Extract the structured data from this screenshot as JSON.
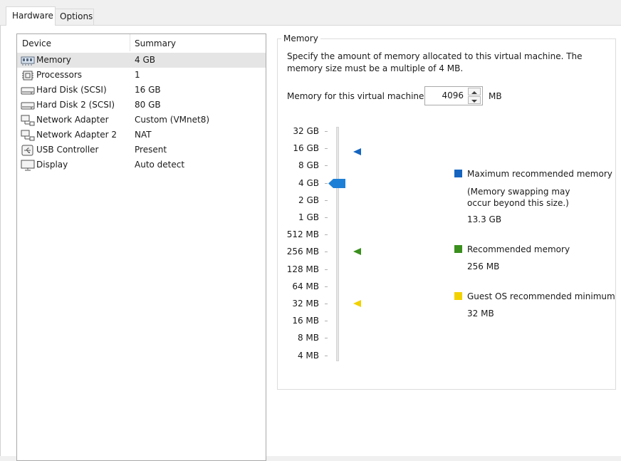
{
  "tabs": [
    {
      "label": "Hardware",
      "active": true
    },
    {
      "label": "Options",
      "active": false
    }
  ],
  "device_list": {
    "columns": [
      "Device",
      "Summary"
    ],
    "rows": [
      {
        "icon": "memory-icon",
        "device": "Memory",
        "summary": "4 GB",
        "selected": true
      },
      {
        "icon": "processor-icon",
        "device": "Processors",
        "summary": "1"
      },
      {
        "icon": "hard-disk-icon",
        "device": "Hard Disk (SCSI)",
        "summary": "16 GB"
      },
      {
        "icon": "hard-disk-icon",
        "device": "Hard Disk 2 (SCSI)",
        "summary": "80 GB"
      },
      {
        "icon": "network-adapter-icon",
        "device": "Network Adapter",
        "summary": "Custom (VMnet8)"
      },
      {
        "icon": "network-adapter-icon",
        "device": "Network Adapter 2",
        "summary": "NAT"
      },
      {
        "icon": "usb-icon",
        "device": "USB Controller",
        "summary": "Present"
      },
      {
        "icon": "display-icon",
        "device": "Display",
        "summary": "Auto detect"
      }
    ]
  },
  "memory": {
    "group_title": "Memory",
    "description": "Specify the amount of memory allocated to this virtual machine. The memory size must be a multiple of 4 MB.",
    "field_label": "Memory for this virtual machine:",
    "value": "4096",
    "unit": "MB",
    "scale": [
      "32 GB",
      "16 GB",
      "8 GB",
      "4 GB",
      "2 GB",
      "1 GB",
      "512 MB",
      "256 MB",
      "128 MB",
      "64 MB",
      "32 MB",
      "16 MB",
      "8 MB",
      "4 MB"
    ],
    "selected_scale": "4 GB",
    "legend": {
      "max": {
        "label": "Maximum recommended memory",
        "note": "(Memory swapping may occur beyond this size.)",
        "value": "13.3 GB",
        "color": "#1565c0"
      },
      "recommended": {
        "label": "Recommended memory",
        "value": "256 MB",
        "color": "#3a8f1d"
      },
      "minimum": {
        "label": "Guest OS recommended minimum",
        "value": "32 MB",
        "color": "#f2d100"
      }
    },
    "accent_color": "#1e7fd6"
  }
}
